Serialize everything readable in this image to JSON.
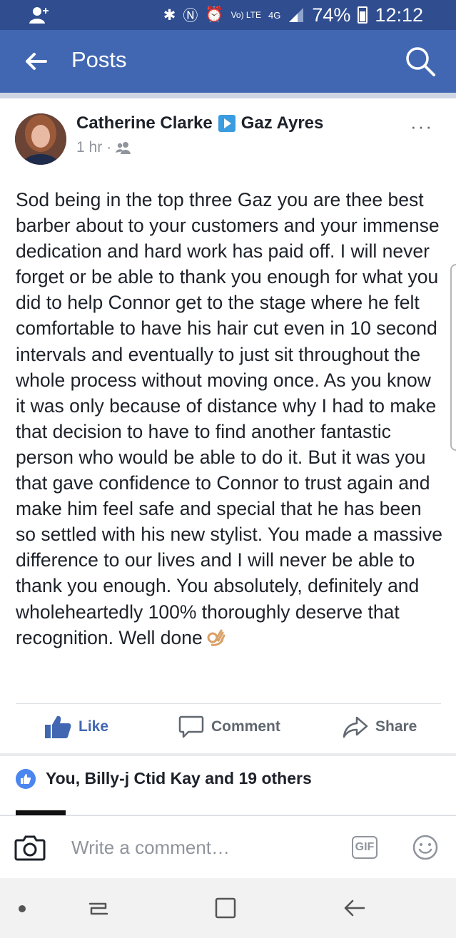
{
  "status_bar": {
    "battery_level": "74%",
    "time": "12:12",
    "network": "4G",
    "volte": "Vo) LTE"
  },
  "nav": {
    "title": "Posts"
  },
  "post": {
    "author": "Catherine Clarke",
    "recipient": "Gaz Ayres",
    "time": "1 hr",
    "separator": "·",
    "body": "Sod being in the top three Gaz you are thee best barber about to your customers and your immense dedication and hard work has paid off. I will never forget or be able to thank you enough for what you did to help Connor get to the stage where he felt comfortable to have his hair cut even in 10 second intervals and eventually to just sit throughout the whole process without moving once. As you know it was only because of distance why I had to make that decision to have to find another fantastic person who would be able to do it. But it was you that gave confidence to Connor to trust again and make him feel safe and special that he has been so settled with his new stylist. You made a massive difference to our lives and I will never be able to thank you enough. You absolutely, definitely and wholeheartedly 100% thoroughly deserve that recognition. Well done",
    "more": "···",
    "actions": {
      "like": "Like",
      "comment": "Comment",
      "share": "Share"
    }
  },
  "reactions": {
    "summary": "You, Billy-j Ctid Kay and 19 others"
  },
  "composer": {
    "placeholder": "Write a comment…",
    "gif_label": "GIF"
  },
  "colors": {
    "brand": "#4267b2",
    "status_bar": "#2f4d8f",
    "text": "#1d2129",
    "muted": "#90949c"
  }
}
